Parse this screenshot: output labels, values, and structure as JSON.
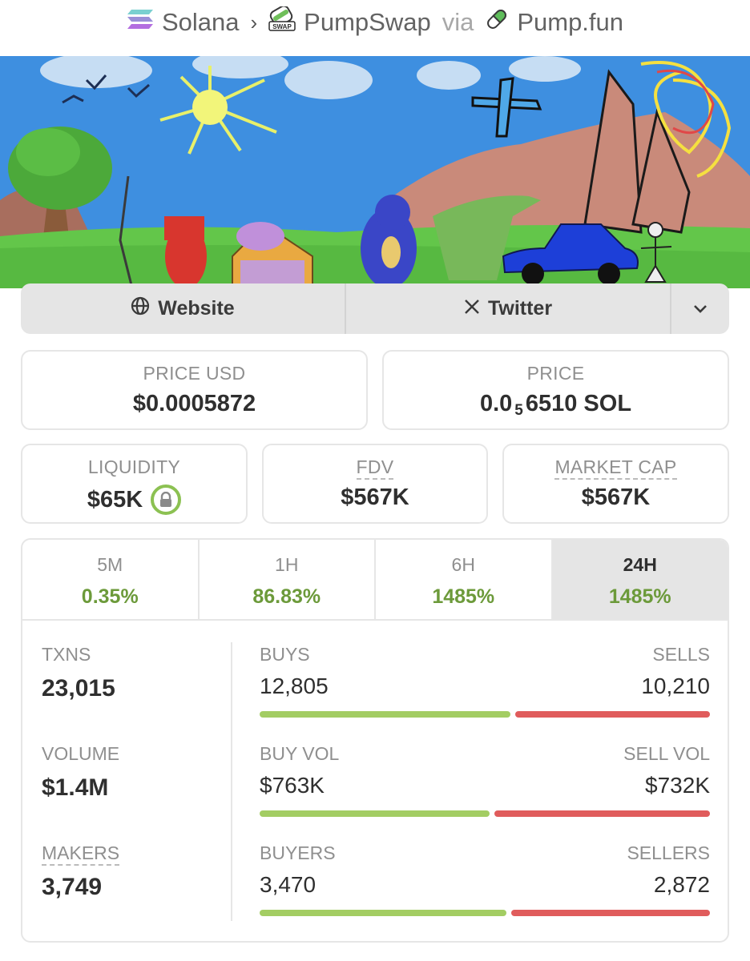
{
  "breadcrumb": {
    "chain": "Solana",
    "dex": "PumpSwap",
    "dex_badge": "SWAP",
    "via": "via",
    "launchpad": "Pump.fun",
    "separator": "›"
  },
  "links": {
    "website": "Website",
    "twitter": "Twitter"
  },
  "price_usd": {
    "label": "PRICE USD",
    "value": "$0.0005872"
  },
  "price_native": {
    "label": "PRICE",
    "prefix": "0.0",
    "subscript": "5",
    "digits": "6510 SOL"
  },
  "liquidity": {
    "label": "LIQUIDITY",
    "value": "$65K",
    "locked": true
  },
  "fdv": {
    "label": "FDV",
    "value": "$567K"
  },
  "market_cap": {
    "label": "MARKET CAP",
    "value": "$567K"
  },
  "timeframes": [
    {
      "label": "5M",
      "change": "0.35%"
    },
    {
      "label": "1H",
      "change": "86.83%"
    },
    {
      "label": "6H",
      "change": "1485%"
    },
    {
      "label": "24H",
      "change": "1485%",
      "active": true
    }
  ],
  "stats": {
    "txns": {
      "label": "TXNS",
      "value": "23,015"
    },
    "volume": {
      "label": "VOLUME",
      "value": "$1.4M"
    },
    "makers": {
      "label": "MAKERS",
      "value": "3,749"
    }
  },
  "pairs": {
    "buys": {
      "label": "BUYS",
      "value": "12,805",
      "sell_label": "SELLS",
      "sell_value": "10,210",
      "buy_ratio": 0.5564
    },
    "volume": {
      "label": "BUY VOL",
      "value": "$763K",
      "sell_label": "SELL VOL",
      "sell_value": "$732K",
      "buy_ratio": 0.5104
    },
    "buyers": {
      "label": "BUYERS",
      "value": "3,470",
      "sell_label": "SELLERS",
      "sell_value": "2,872",
      "buy_ratio": 0.5472
    }
  },
  "colors": {
    "positive": "#6c9a3a",
    "buy_bar": "#a3cd63",
    "sell_bar": "#e05c5c",
    "lock": "#8cc152"
  },
  "icons": {
    "chain": "solana-logo-icon",
    "dex": "pumpswap-logo-icon",
    "launchpad": "pill-icon",
    "website": "globe-icon",
    "twitter": "x-logo-icon",
    "more": "chevron-down-icon",
    "liquidity": "lock-icon"
  }
}
